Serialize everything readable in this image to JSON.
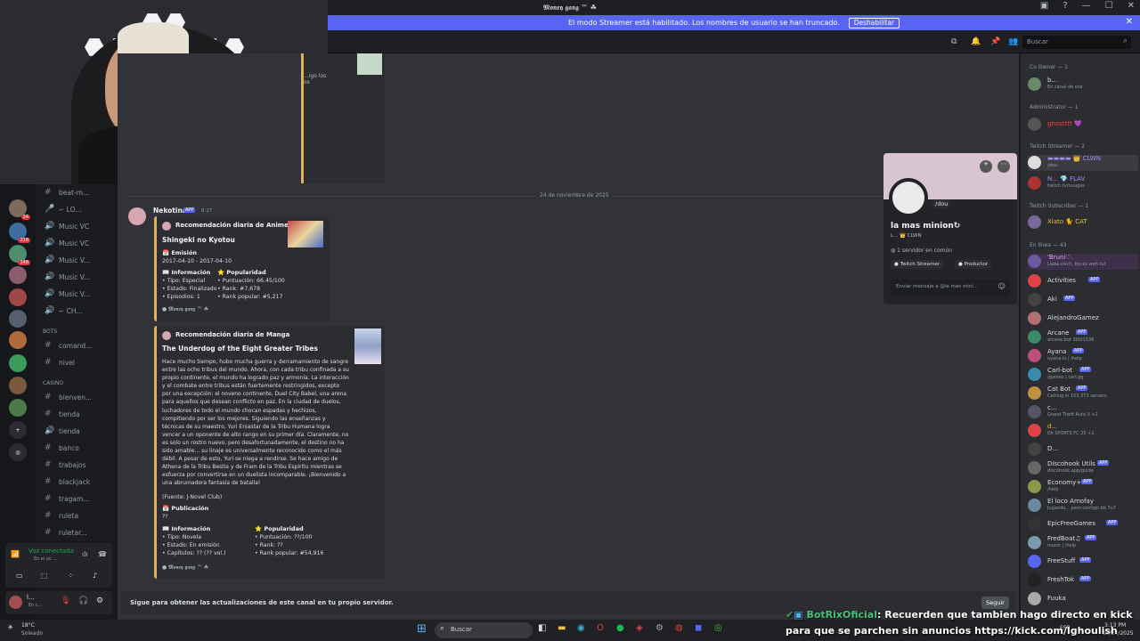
{
  "title_bar": {
    "server_name": "𝕸𝖔𝖓𝖊𝖞 𝖌𝖆𝖓𝖌 ™ ☘"
  },
  "streamer_banner": {
    "text": "El modo Streamer está habilitado. Los nombres de usuario se han truncado.",
    "button": "Deshabilitar"
  },
  "search": {
    "placeholder": "Buscar"
  },
  "taskbar": {
    "search": "Buscar",
    "time": "3:13 PM",
    "date": "11/24/2025",
    "weather_temp": "18°C",
    "weather_label": "Soleado",
    "lang": "ESP"
  },
  "channels": {
    "items": [
      "beat-m...",
      "⌐ LO...",
      "Music VC",
      "Music VC",
      "Music V...",
      "Music V...",
      "Music V...",
      "⌐ CH..."
    ],
    "cat_bots": "BOTS",
    "bots": [
      "comand...",
      "nivel"
    ],
    "cat_casino": "CASINO",
    "casino": [
      "bienven...",
      "tienda",
      "tienda",
      "banco",
      "trabajos",
      "blackjack",
      "tragam...",
      "ruleta",
      "ruletar..."
    ]
  },
  "voice": {
    "status": "Voz conectada",
    "channel": "En el pc ..."
  },
  "user": {
    "name": "l...",
    "status": "En c..."
  },
  "servers": [
    {
      "badge": "24"
    },
    {
      "badge": "218"
    },
    {
      "badge": "148"
    },
    {
      "badge": ""
    },
    {
      "badge": ""
    },
    {
      "badge": ""
    },
    {
      "badge": ""
    },
    {
      "badge": ""
    },
    {
      "badge": ""
    },
    {
      "badge": ""
    },
    {
      "badge": ""
    }
  ],
  "chat": {
    "date_divider": "24 de noviembre de 2025",
    "author": "Nekotina",
    "app_tag": "APP",
    "time": "8:27",
    "top_snippet": "...igo los\nos",
    "anime": {
      "header": "Recomendación diaria de Anime",
      "title": "Shingeki no Kyotou",
      "emision_label": "Emisión",
      "emision": "2017-04-10 - 2017-04-10",
      "info_label": "Información",
      "info": [
        "• Tipo: Especial",
        "• Estado: Finalizado",
        "• Episodios: 1"
      ],
      "pop_label": "Popularidad",
      "pop": [
        "• Puntuación: 66.45/100",
        "• Rank: #7,678",
        "• Rank popular: #5,217"
      ],
      "footer": "𝕸𝖔𝖓𝖊𝖞 𝖌𝖆𝖓𝖌 ™ ☘"
    },
    "manga": {
      "header": "Recomendación diaria de Manga",
      "title": "The Underdog of the Eight Greater Tribes",
      "synopsis": "Hace mucho tiempo, hubo mucha guerra y derramamiento de sangre entre las ocho tribus del mundo. Ahora, con cada tribu confinada a su propio continente, el mundo ha logrado paz y armonía. La interacción y el combate entre tribus están fuertemente restringidos, excepto por una excepción: el noveno continente, Duel City Babel, una arena para aquellos que desean conflicto en paz. En la ciudad de duelos, luchadores de todo el mundo chocan espadas y hechizos, compitiendo por ser los mejores. Siguiendo las enseñanzas y técnicas de su maestro, Yuri Eniastar de la Tribu Humana logra vencer a un oponente de alto rango en su primer día. Claramente, no es solo un rostro nuevo, pero desafortunadamente, el destino no ha sido amable... su linaje es universalmente reconocido como el más débil. A pesar de esto, Yuri se niega a rendirse. Se hace amigo de Athena de la Tribu Bestia y de Fram de la Tribu Espíritu mientras se esfuerza por convertirse en un duelista incomparable. ¡Bienvenido a una abrumadora fantasía de batalla!",
      "source": "(Fuente: J-Novel Club)",
      "pub_label": "Publicación",
      "pub": "??",
      "info_label": "Información",
      "info": [
        "• Tipo: Novela",
        "• Estado: En emisión",
        "• Capítulos: ?? (?? vol.)"
      ],
      "pop_label": "Popularidad",
      "pop": [
        "• Puntuación: ??/100",
        "• Rank: ??",
        "• Rank popular: #54,916"
      ],
      "footer": "𝕸𝖔𝖓𝖊𝖞 𝖌𝖆𝖓𝖌 ™ ☘"
    },
    "follow_bar": "Sigue para obtener las actualizaciones de este canal en tu propio servidor.",
    "follow_button": "Seguir"
  },
  "profile": {
    "tag": "/dou",
    "name": "la mas minion↻",
    "sub": "L... 👑 CLWN",
    "common": "1 servidor en común",
    "roles": [
      "Twitch Streamer",
      "Productor"
    ],
    "message_placeholder": "Enviar mensaje a @la mas mini..."
  },
  "members": {
    "groups": [
      "Co Owner — 1",
      "Administrator — 1",
      "Twitch Streamer — 2",
      "Twitch Subscriber — 1",
      "En línea — 43"
    ],
    "list": [
      {
        "name": "b...",
        "status": "En canal de voz"
      },
      {
        "name": "ghostttt 💜",
        "status": ""
      },
      {
        "name": "▬▬▬▬ 👑 CLWN",
        "status": "/dou"
      },
      {
        "name": "N... 💎 FLAV",
        "status": "twitch.tv/nuugas"
      },
      {
        "name": "Xiato 🐈 CAT",
        "status": ""
      },
      {
        "name": "'Bruni♡.",
        "status": "Llabe:mich, bis es weh tut"
      },
      {
        "name": "Activities",
        "status": ""
      },
      {
        "name": "Aki",
        "status": ""
      },
      {
        "name": "AlejandroGamez",
        "status": ""
      },
      {
        "name": "Arcane",
        "status": "arcane.bot 300/1536"
      },
      {
        "name": "Ayana",
        "status": "ayana.io | /help"
      },
      {
        "name": "Carl-bot",
        "status": "/games | carl.gg"
      },
      {
        "name": "Cat Bot",
        "status": "Catting in 153,373 servers"
      },
      {
        "name": "c...",
        "status": "Grand Theft Auto V +1"
      },
      {
        "name": "d...",
        "status": "EA SPORTS FC 25 +1"
      },
      {
        "name": "D...",
        "status": ""
      },
      {
        "name": "Discohook Utils",
        "status": "discohook.app/guide"
      },
      {
        "name": "Economy+",
        "status": "/help"
      },
      {
        "name": "El loco Amofay",
        "status": "Jugando... pero contigo bb 7u7"
      },
      {
        "name": "EpicFreeGames",
        "status": ""
      },
      {
        "name": "FredBoat♫",
        "status": "music | /help"
      },
      {
        "name": "FreeStuff",
        "status": ""
      },
      {
        "name": "FreshTok",
        "status": ""
      },
      {
        "name": "Fuuka",
        "status": ""
      }
    ]
  },
  "overlay": {
    "user": "BotRixOficial",
    "message": ": Recuerden que tambien hago directo en kick para que se parchen sin anuncios https://kick.com/lghoulish"
  },
  "colors": {
    "accent": "#5865f2",
    "embed_bar": "#e0b15c",
    "bg": "#313338"
  }
}
